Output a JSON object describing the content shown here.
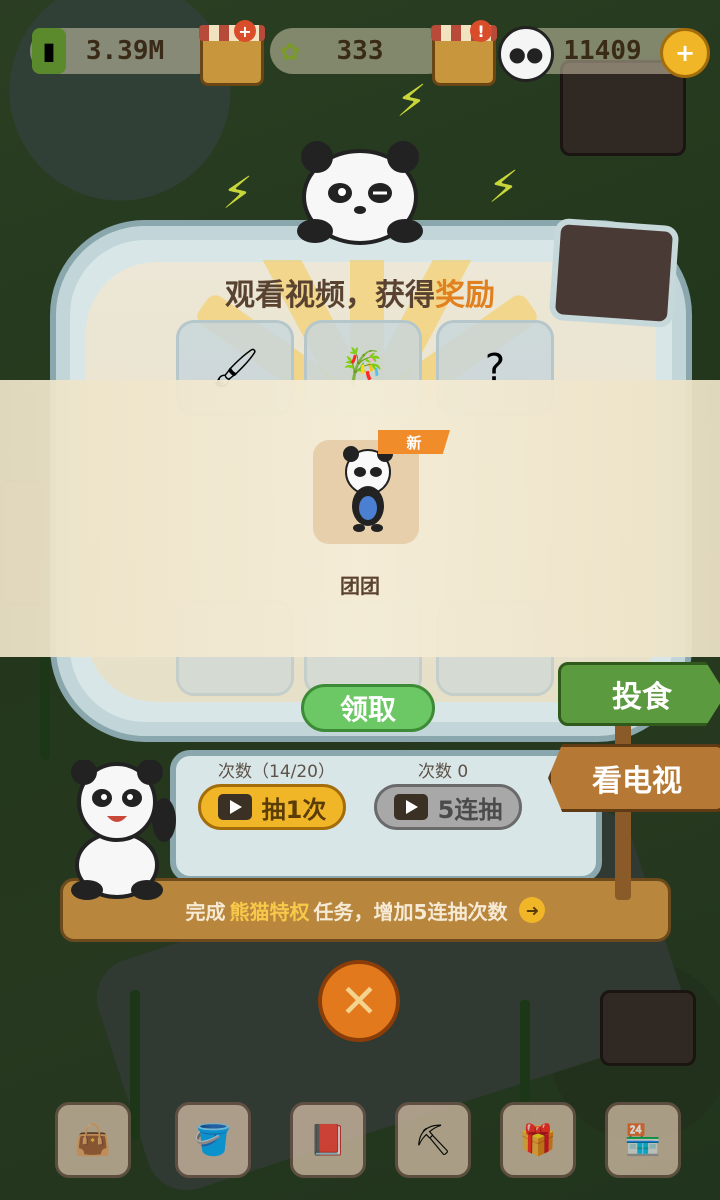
{
  "topbar": {
    "bamboo_count": "3.39M",
    "shoot_count": "333",
    "panda_coin_count": "11409"
  },
  "machine": {
    "title_part1": "观看视频，获得",
    "title_highlight": "奖励"
  },
  "reward": {
    "new_tag": "新",
    "item_name": "团团",
    "claim_label": "领取"
  },
  "draws": {
    "single_count_label": "次数（14/20）",
    "single_label": "抽1次",
    "five_count_label": "次数 0",
    "five_label": "5连抽"
  },
  "task": {
    "prefix": "完成",
    "highlight": "熊猫特权",
    "suffix": "任务，增加5连抽次数"
  },
  "signs": {
    "feed_label": "投食",
    "tv_label": "看电视"
  },
  "colors": {
    "accent_orange": "#e0801f",
    "claim_green": "#6cc865",
    "draw_gold": "#f0b627"
  }
}
